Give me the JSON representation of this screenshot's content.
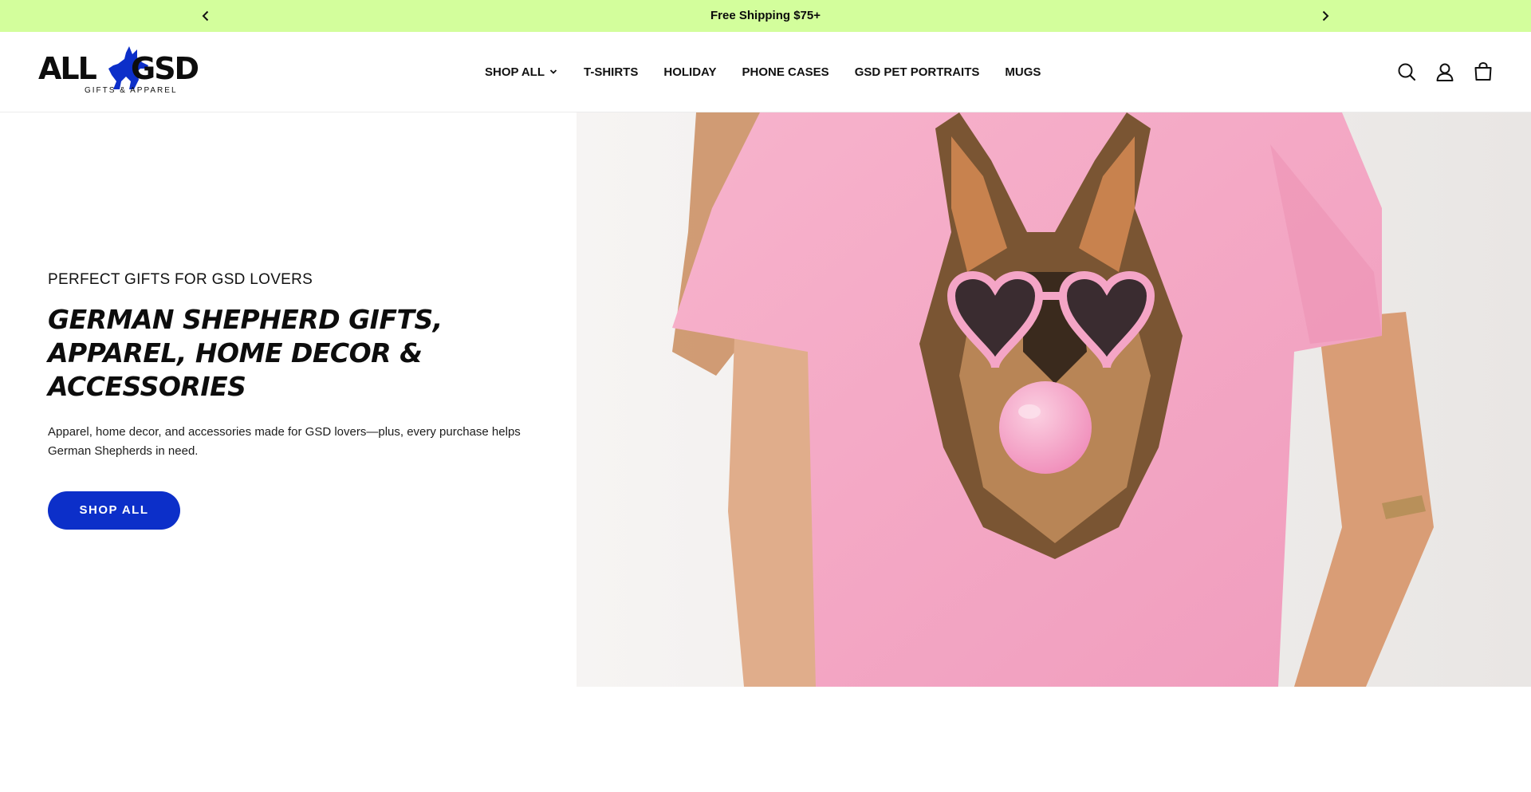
{
  "announcement": {
    "message": "Free Shipping $75+",
    "prev_icon": "chevron-left-icon",
    "next_icon": "chevron-right-icon"
  },
  "header": {
    "logo": {
      "word_left": "ALL",
      "word_right": "GSD",
      "tagline": "GIFTS & APPAREL",
      "brand_color": "#0c2fc9"
    },
    "nav": [
      {
        "label": "SHOP ALL",
        "has_dropdown": true
      },
      {
        "label": "T-SHIRTS"
      },
      {
        "label": "HOLIDAY"
      },
      {
        "label": "PHONE CASES"
      },
      {
        "label": "GSD PET PORTRAITS"
      },
      {
        "label": "MUGS"
      }
    ],
    "icons": [
      "search-icon",
      "account-icon",
      "cart-icon"
    ]
  },
  "hero": {
    "eyebrow": "PERFECT GIFTS FOR GSD LOVERS",
    "headline": "GERMAN SHEPHERD GIFTS, APPAREL, HOME DECOR & ACCESSORIES",
    "description": "Apparel, home decor, and accessories made for GSD lovers—plus, every purchase helps German Shepherds in need.",
    "cta_label": "SHOP ALL",
    "cta_color": "#0c2fc9"
  },
  "colors": {
    "announcement_bg": "#d3fe9c",
    "shirt_pink": "#f5a9c6"
  }
}
